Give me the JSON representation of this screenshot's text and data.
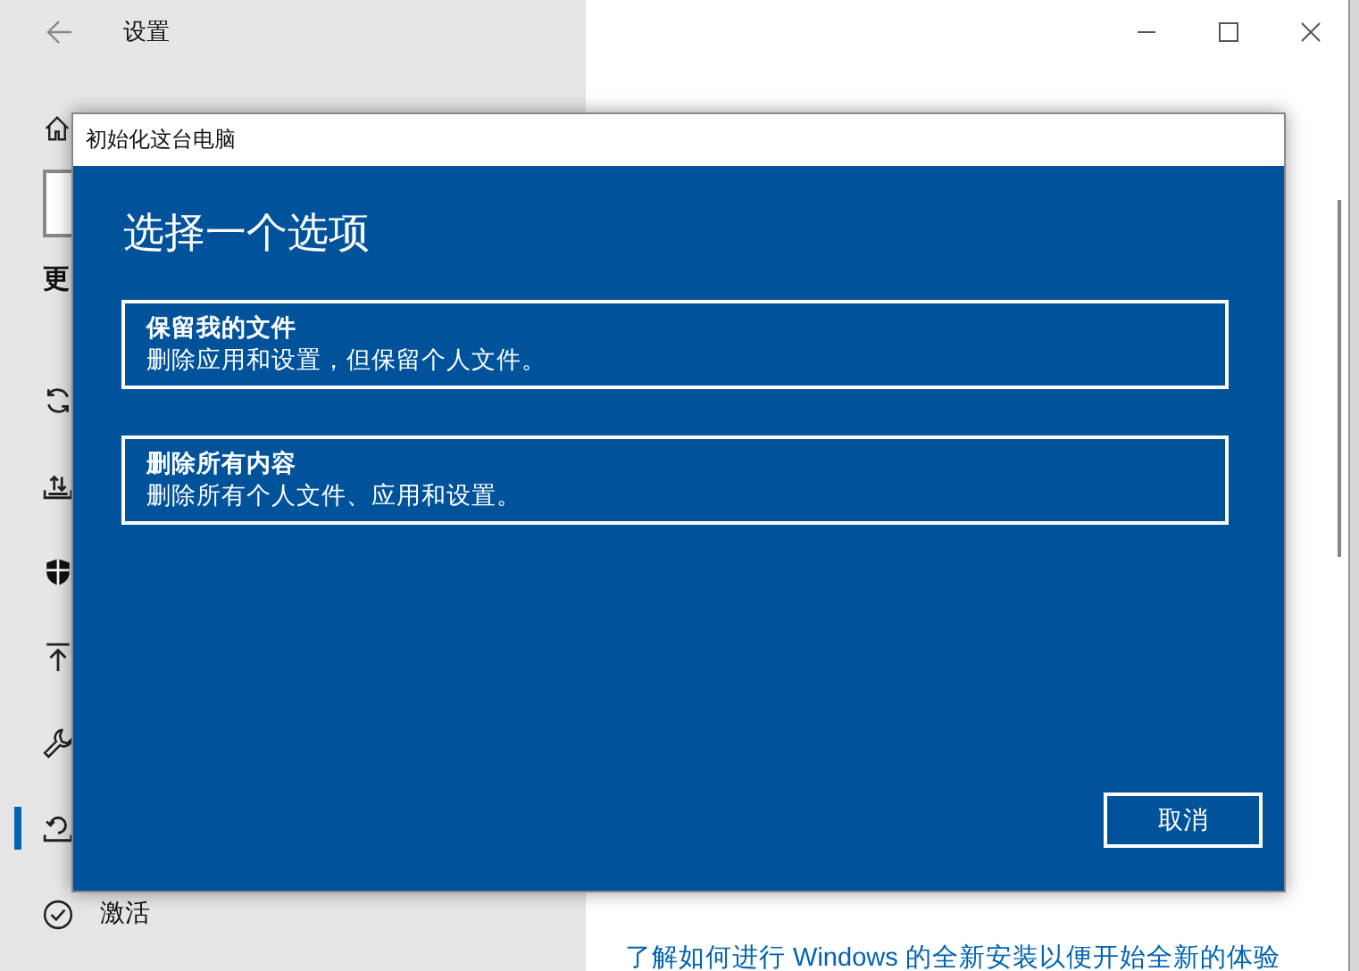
{
  "window": {
    "title": "设置"
  },
  "sidebar": {
    "heading": "更",
    "items": [
      {
        "kind": "sync",
        "selected": false
      },
      {
        "kind": "delivery",
        "selected": false
      },
      {
        "kind": "shield",
        "selected": false
      },
      {
        "kind": "backup",
        "selected": false
      },
      {
        "kind": "wrench",
        "selected": false
      },
      {
        "kind": "recovery",
        "selected": true
      },
      {
        "kind": "activation",
        "label": "激活",
        "selected": false
      }
    ]
  },
  "content": {
    "link": "了解如何进行 Windows 的全新安装以便开始全新的体验"
  },
  "dialog": {
    "title": "初始化这台电脑",
    "heading": "选择一个选项",
    "options": [
      {
        "title": "保留我的文件",
        "description": "删除应用和设置，但保留个人文件。"
      },
      {
        "title": "删除所有内容",
        "description": "删除所有个人文件、应用和设置。"
      }
    ],
    "cancel": "取消"
  }
}
